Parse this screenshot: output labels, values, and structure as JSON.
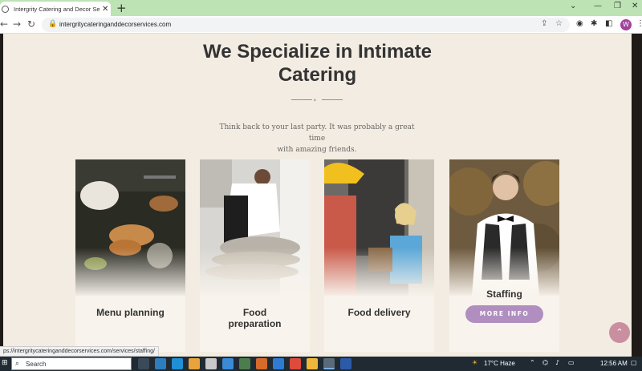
{
  "browser": {
    "tab_title": "Intergrity Catering and Decor Se",
    "url": "intergritycateringanddecorservices.com",
    "profile_initial": "W",
    "status_url": "ps://intergritycateringanddecorservices.com/services/staffing/"
  },
  "page": {
    "heading_line1": "We Specialize in Intimate",
    "heading_line2": "Catering",
    "subtext_line1": "Think back to your last party. It was probably a great time",
    "subtext_line2": "with amazing friends.",
    "cards": [
      {
        "title_line1": "Menu planning",
        "title_line2": ""
      },
      {
        "title_line1": "Food",
        "title_line2": "preparation"
      },
      {
        "title_line1": "Food delivery",
        "title_line2": ""
      },
      {
        "title_line1": "Staffing",
        "title_line2": "",
        "button": "MORE INFO"
      }
    ]
  },
  "taskbar": {
    "search_label": "Search",
    "weather": "17°C  Haze",
    "time": "12:56 AM"
  },
  "colors": {
    "page_bg": "#f3ece2",
    "accent_button": "#b08fc0",
    "tab_strip": "#bde3b4",
    "scroll_top": "#c98fa0"
  },
  "icons": [
    "favicon-icon",
    "close-icon",
    "plus-icon",
    "chevron-down-icon",
    "minimize-icon",
    "maximize-icon",
    "window-close-icon",
    "back-icon",
    "forward-icon",
    "reload-icon",
    "lock-icon",
    "share-icon",
    "star-icon",
    "extension-icon",
    "puzzle-icon",
    "sidebar-icon",
    "menu-icon",
    "arrow-up-icon",
    "windows-icon",
    "search-icon"
  ]
}
